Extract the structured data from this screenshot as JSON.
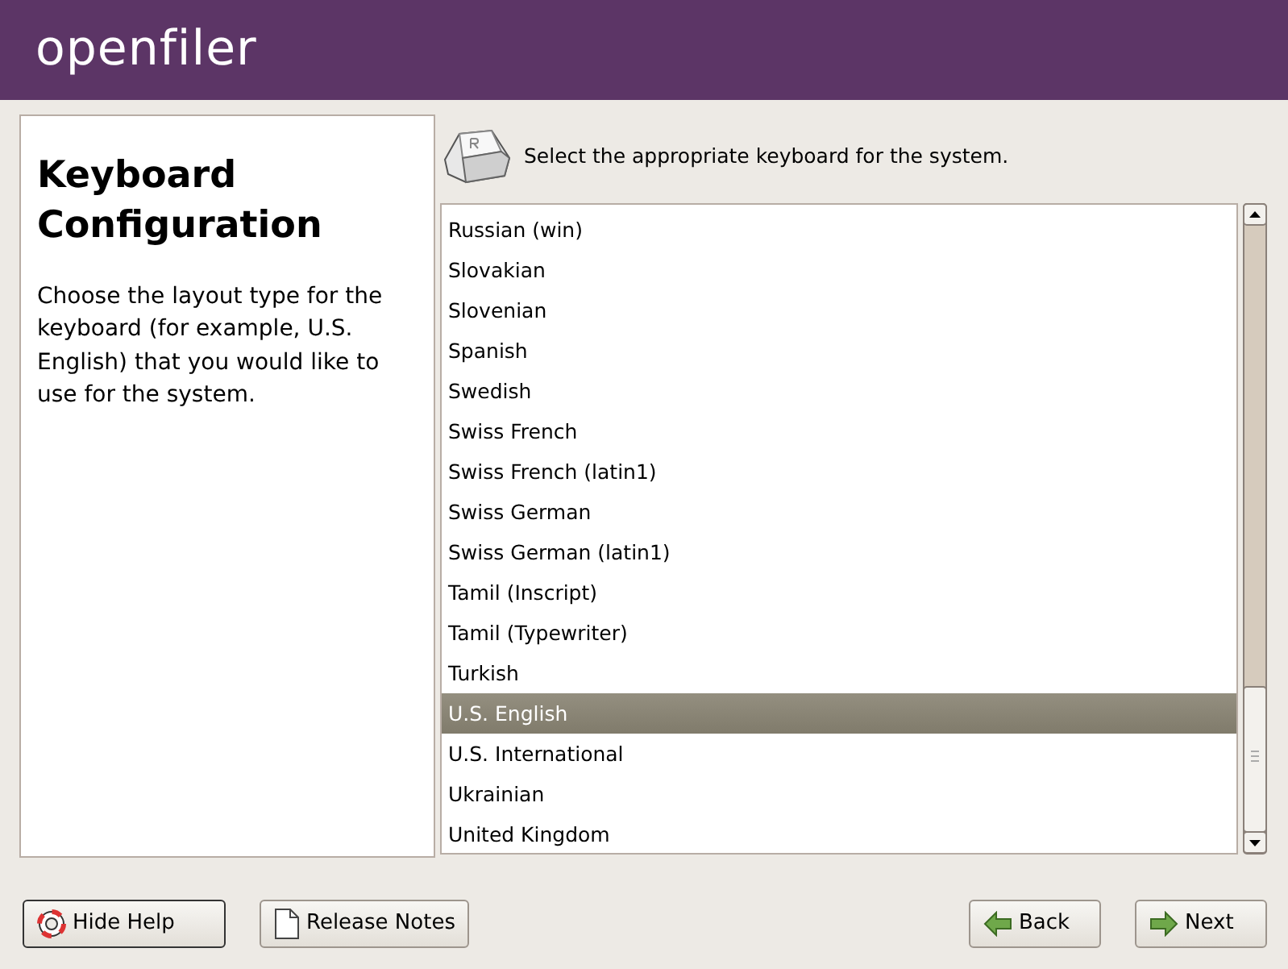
{
  "header": {
    "logo": "openfiler"
  },
  "help": {
    "title": "Keyboard Configuration",
    "text": "Choose the layout type for the keyboard (for example, U.S. English) that you would like to use for the system."
  },
  "prompt": "Select the appropriate keyboard for the system.",
  "keyboards": [
    {
      "label": "Russian (win)",
      "selected": false
    },
    {
      "label": "Slovakian",
      "selected": false
    },
    {
      "label": "Slovenian",
      "selected": false
    },
    {
      "label": "Spanish",
      "selected": false
    },
    {
      "label": "Swedish",
      "selected": false
    },
    {
      "label": "Swiss French",
      "selected": false
    },
    {
      "label": "Swiss French (latin1)",
      "selected": false
    },
    {
      "label": "Swiss German",
      "selected": false
    },
    {
      "label": "Swiss German (latin1)",
      "selected": false
    },
    {
      "label": "Tamil (Inscript)",
      "selected": false
    },
    {
      "label": "Tamil (Typewriter)",
      "selected": false
    },
    {
      "label": "Turkish",
      "selected": false
    },
    {
      "label": "U.S. English",
      "selected": true
    },
    {
      "label": "U.S. International",
      "selected": false
    },
    {
      "label": "Ukrainian",
      "selected": false
    },
    {
      "label": "United Kingdom",
      "selected": false
    }
  ],
  "buttons": [
    {
      "label": "Hide Help",
      "kind": "help"
    },
    {
      "label": "Release Notes",
      "kind": "notes"
    },
    {
      "label": "Back",
      "kind": "back"
    },
    {
      "label": "Next",
      "kind": "next"
    }
  ]
}
